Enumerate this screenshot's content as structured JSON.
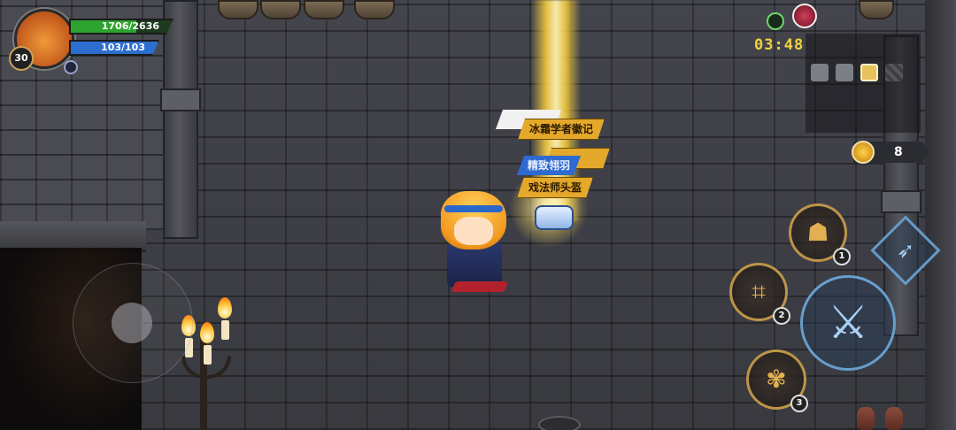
{
  "player": {
    "level": "30",
    "hp": "1706/2636",
    "hp_fraction": 0.647,
    "mp": "103/103",
    "mp_fraction": 1.0
  },
  "timer": "03:48",
  "coins": "8",
  "loot_labels": [
    "冰霜学者徽记",
    "精致翎羽",
    "戏法师头盔"
  ],
  "skills": [
    {
      "number": "1",
      "icon": "summon-icon"
    },
    {
      "number": "2",
      "icon": "net-icon"
    },
    {
      "number": "3",
      "icon": "beetle-icon"
    }
  ],
  "icons": {
    "attack": "sword-icon",
    "dodge": "dash-icon",
    "timer": "stopwatch-icon",
    "boss": "boss-icon",
    "coin": "crown-coin-icon"
  },
  "colors": {
    "hp": "#2da32f",
    "mp": "#2c6ed0",
    "timer": "#f2d23d",
    "skill_ring": "#e2b052",
    "attack_ring": "#6eaadc"
  }
}
